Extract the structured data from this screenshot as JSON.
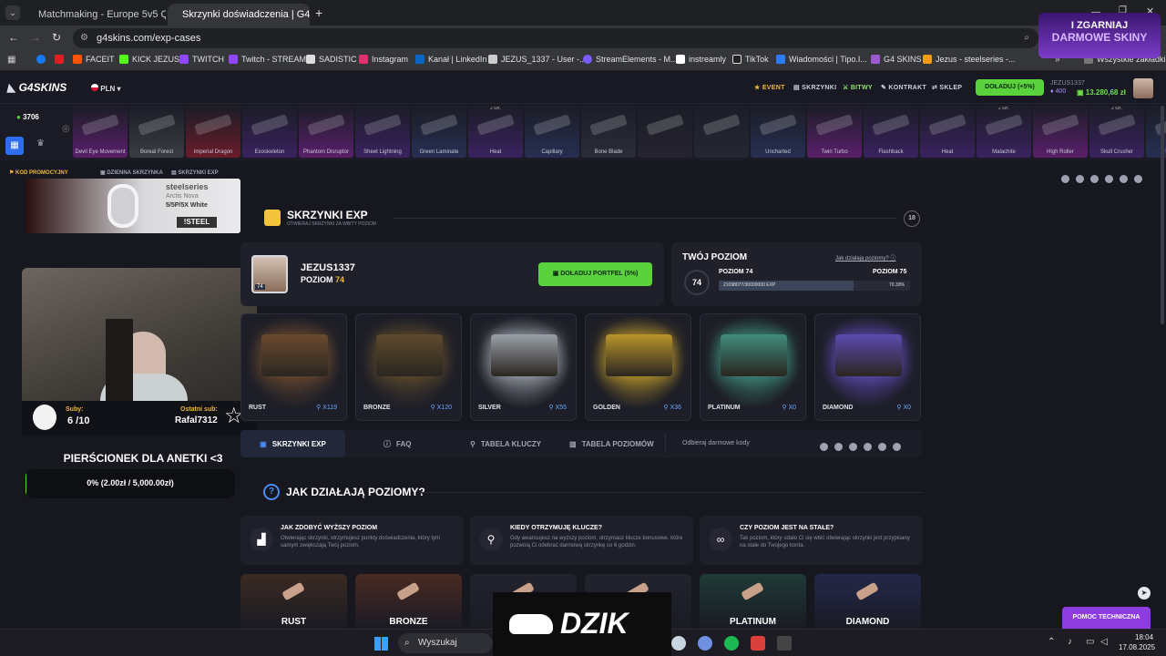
{
  "tabs": [
    {
      "title": "Matchmaking - Europe 5v5 Qu",
      "active": false
    },
    {
      "title": "Skrzynki doświadczenia | G4Sk",
      "active": true
    }
  ],
  "new_tab": "+",
  "url": "g4skins.com/exp-cases",
  "bookmarks": [
    "FACEIT",
    "KICK JEZUS",
    "TWITCH",
    "Twitch - STREAM",
    "SADISTIC",
    "Instagram",
    "Kanał | LinkedIn",
    "JEZUS_1337 - User -...",
    "StreamElements - M...",
    "instreamly",
    "TikTok",
    "Wiadomości | Tipo.I...",
    "G4 SKINS",
    "Jezus - steelseries -..."
  ],
  "bookmarks_all": "Wszystkie zakładki",
  "promo_banner": {
    "line1": "I ZGARNIAJ",
    "line2": "DARMOWE SKINY"
  },
  "site": {
    "logo": "G4SKINS",
    "currency": "PLN",
    "nav": [
      "EVENT",
      "SKRZYNKI",
      "BITWY",
      "KONTRAKT",
      "SKLEP"
    ],
    "deposit_btn": "DOŁADUJ (+5%)",
    "username": "JEZUS1337",
    "points": "400",
    "balance": "13.280,68 zł",
    "online": "3706"
  },
  "strip": [
    {
      "name": "Devil Eye Movement",
      "c": "#5a1f6b"
    },
    {
      "name": "Boreal Forest",
      "c": "#3b3d42"
    },
    {
      "name": "Imperial Dragon",
      "c": "#6b1c2a"
    },
    {
      "name": "Exoskeleton",
      "c": "#3a2260"
    },
    {
      "name": "Phantom Disruptor",
      "c": "#5a1f6b"
    },
    {
      "name": "Sheet Lightning",
      "c": "#3a2260"
    },
    {
      "name": "Green Laminate",
      "c": "#262f52"
    },
    {
      "name": "Heat",
      "c": "#3a2260",
      "badge": "2 szt."
    },
    {
      "name": "Capillary",
      "c": "#262f52"
    },
    {
      "name": "Bone Blade",
      "c": "#2a2d3a"
    },
    {
      "name": "",
      "c": "#24232f"
    },
    {
      "name": "",
      "c": "#262734"
    },
    {
      "name": "Uncharted",
      "c": "#262f52"
    },
    {
      "name": "Twin Turbo",
      "c": "#5a1f6b"
    },
    {
      "name": "Flashback",
      "c": "#3a2260"
    },
    {
      "name": "Heat",
      "c": "#3a2260"
    },
    {
      "name": "Malachite",
      "c": "#3a2260",
      "badge": "2 szt."
    },
    {
      "name": "High Roller",
      "c": "#5a1f6b"
    },
    {
      "name": "Skull Crusher",
      "c": "#3a2260",
      "badge": "2 szt."
    },
    {
      "name": "Uncha",
      "c": "#262f52"
    }
  ],
  "subnav": [
    "KOD PROMOCYJNY",
    "DZIENNA SKRZYNKA",
    "SKRZYNKI EXP"
  ],
  "overlay": {
    "ad": {
      "brand": "steelseries",
      "model": "Arctis Nova",
      "variant": "5/5P/5X White",
      "cmd": "!STEEL"
    },
    "subs_label": "Suby:",
    "subs": "6 /10",
    "last_sub_label": "Ostatni sub:",
    "last_sub": "Rafal7312",
    "goal_title": "PIERŚCIONEK DLA ANETKI <3",
    "goal_progress": "0% (2.00zł / 5,000.00zł)",
    "goal_pct": 0.04
  },
  "section": {
    "title": "SKRZYNKI EXP",
    "subtitle": "OTWIERAJ SKRZYNKI ZA WBITY POZIOM",
    "age": "18"
  },
  "profile": {
    "name": "JEZUS1337",
    "level_label": "POZIOM",
    "level": "74",
    "badge": "74",
    "btn": "DOŁADUJ PORTFEL (5%)"
  },
  "level_box": {
    "title": "TWÓJ POZIOM",
    "help": "Jak działają poziomy?",
    "current": "POZIOM 74",
    "next": "POZIOM 75",
    "exp": "21098077/30000000 EXP",
    "percent": "70.33%",
    "fraction": 0.7033,
    "badge": "74"
  },
  "cases": [
    {
      "name": "RUST",
      "count": "X119",
      "c": "#6b4a2f"
    },
    {
      "name": "BRONZE",
      "count": "X120",
      "c": "#5e4a2c"
    },
    {
      "name": "SILVER",
      "count": "X55",
      "c": "#9aa0a8"
    },
    {
      "name": "GOLDEN",
      "count": "X36",
      "c": "#b8952a"
    },
    {
      "name": "PLATINUM",
      "count": "X0",
      "c": "#3f8c7c"
    },
    {
      "name": "DIAMOND",
      "count": "X0",
      "c": "#5c4ab0"
    }
  ],
  "case_tabs": [
    "SKRZYNKI EXP",
    "FAQ",
    "TABELA KLUCZY",
    "TABELA POZIOMÓW"
  ],
  "free_codes": "Odbieraj darmowe kody",
  "faq_title": "JAK DZIAŁAJĄ POZIOMY?",
  "faq": [
    {
      "title": "JAK ZDOBYĆ WYŻSZY POZIOM",
      "desc": "Otwierając skrzynki, otrzymujesz punkty doświadczenia, który tym samym zwiększają Twój poziom."
    },
    {
      "title": "KIEDY OTRZYMUJĘ KLUCZE?",
      "desc": "Gdy awansujesz na wyższy poziom, otrzymasz klucze bonusowe, które pozwolą Ci odebrać darmową skrzynkę co 6 godzin."
    },
    {
      "title": "CZY POZIOM JEST NA STAŁE?",
      "desc": "Tak poziom, który udało Ci się wbić otwierając skrzynki jest przypisany na stałe do Twojego konta."
    }
  ],
  "levels": [
    {
      "name": "RUST",
      "c": "#3a2a22"
    },
    {
      "name": "BRONZE",
      "c": "#4a2a22"
    },
    {
      "name": "",
      "c": "#22232d"
    },
    {
      "name": "",
      "c": "#22232d"
    },
    {
      "name": "PLATINUM",
      "c": "#1f3a36"
    },
    {
      "name": "DIAMOND",
      "c": "#23284a"
    }
  ],
  "support_btn": "POMOC TECHNICZNA",
  "dzik": "DZIK",
  "taskbar": {
    "search": "Wyszukaj",
    "time": "18:04",
    "date": "17.08.2025"
  }
}
